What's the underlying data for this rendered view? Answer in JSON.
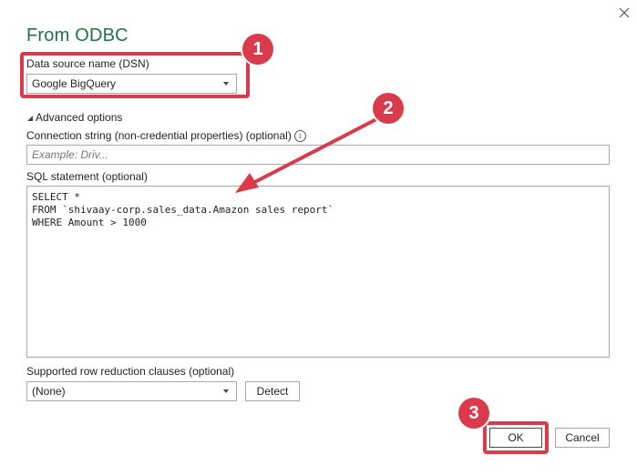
{
  "dialog": {
    "title": "From ODBC"
  },
  "dsn": {
    "label": "Data source name (DSN)",
    "value": "Google BigQuery"
  },
  "advanced": {
    "toggle_label": "Advanced options"
  },
  "connection_string": {
    "label": "Connection string (non-credential properties) (optional)",
    "placeholder": "Example: Driv..."
  },
  "sql": {
    "label": "SQL statement (optional)",
    "value": "SELECT *\nFROM `shivaay-corp.sales_data.Amazon sales report`\nWHERE Amount > 1000"
  },
  "row_reduction": {
    "label": "Supported row reduction clauses (optional)",
    "value": "(None)",
    "detect_label": "Detect"
  },
  "footer": {
    "ok_label": "OK",
    "cancel_label": "Cancel"
  },
  "annotations": {
    "badge1": "1",
    "badge2": "2",
    "badge3": "3",
    "color": "#d93a4c"
  },
  "icons": {
    "close": "close-icon",
    "info": "info-icon",
    "caret": "chevron-down-icon",
    "collapse": "triangle-collapse-icon"
  }
}
